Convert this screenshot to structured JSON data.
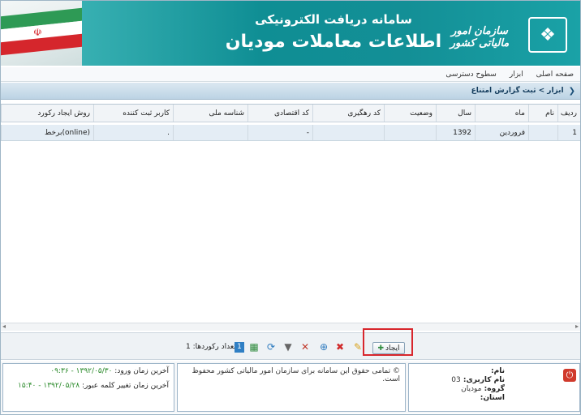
{
  "header": {
    "title_line1": "سامانه دریافت الکترونیکی",
    "title_line2": "اطلاعات معاملات مودیان",
    "org_name": "سازمان امور مالیاتی کشور",
    "logo_icon": "emblem-icon",
    "flag_icon": "iran-flag-icon"
  },
  "menu": {
    "items": [
      "صفحه اصلی",
      "ابزار",
      "سطوح دسترسی"
    ]
  },
  "breadcrumb": {
    "text": "ابزار > ثبت گزارش امتناع"
  },
  "grid": {
    "columns": [
      "ردیف",
      "نام",
      "ماه",
      "سال",
      "وضعیت",
      "کد رهگیری",
      "کد اقتصادی",
      "شناسه ملی",
      "کاربر ثبت کننده",
      "روش ایجاد رکورد"
    ],
    "rows": [
      [
        "1",
        "",
        "فروردین",
        "1392",
        "",
        "",
        "-",
        "",
        ".",
        "(online)برخط"
      ]
    ]
  },
  "toolbar": {
    "create_label": "ایجاد",
    "record_count_label": "تعداد رکوردها: 1",
    "page": "1"
  },
  "footer": {
    "copyright": "© تمامی حقوق این سامانه برای سازمان امور مالیاتی کشور محفوظ است.",
    "last_login_label": "آخرین زمان ورود:",
    "last_login_value": "۱۳۹۲/۰۵/۳۰ - ۰۹:۳۶",
    "last_password_change_label": "آخرین زمان تغییر کلمه عبور:",
    "last_password_change_value": "۱۳۹۲/۰۵/۲۸ - ۱۵:۴۰",
    "name_label": "نام:",
    "name_value": "",
    "username_label": "نام کاربری:",
    "username_value": "03",
    "group_label": "گروه:",
    "group_value": "مودیان",
    "province_label": "استان:",
    "province_value": ""
  },
  "colors": {
    "banner": "#138f96",
    "highlight": "#d8262c",
    "selected_row": "#e4edf5"
  }
}
